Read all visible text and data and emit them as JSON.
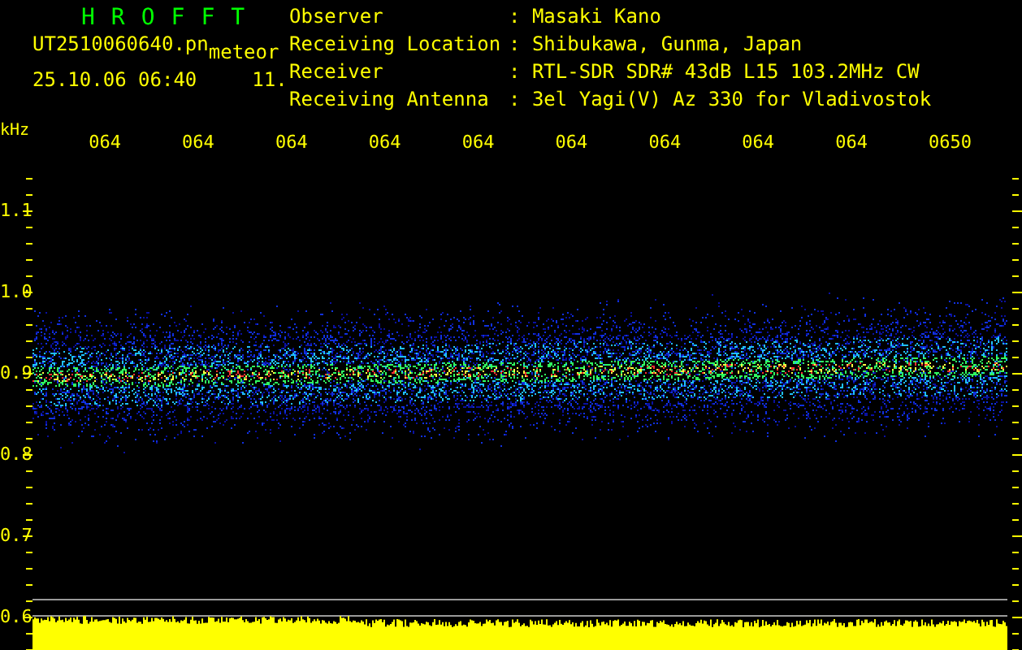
{
  "app": {
    "title": "HROFFT",
    "file_name": "UT2510060640.pn",
    "tag": "meteor",
    "timestamp": "25.10.06 06:40",
    "counter": "11."
  },
  "info": [
    {
      "label": "Observer",
      "value": ": Masaki Kano"
    },
    {
      "label": "Receiving Location",
      "value": ": Shibukawa, Gunma, Japan"
    },
    {
      "label": "Receiver",
      "value": ": RTL-SDR SDR# 43dB L15 103.2MHz CW"
    },
    {
      "label": "Receiving Antenna",
      "value": ": 3el Yagi(V) Az 330 for Vladivostok"
    }
  ],
  "plot": {
    "unit": "kHz",
    "time_labels": [
      "064",
      "064",
      "064",
      "064",
      "064",
      "064",
      "064",
      "064",
      "064",
      "0650"
    ],
    "freq_labels": [
      "1.1",
      "1.0",
      "0.9",
      "0.8",
      "0.7",
      "0.6"
    ]
  }
}
